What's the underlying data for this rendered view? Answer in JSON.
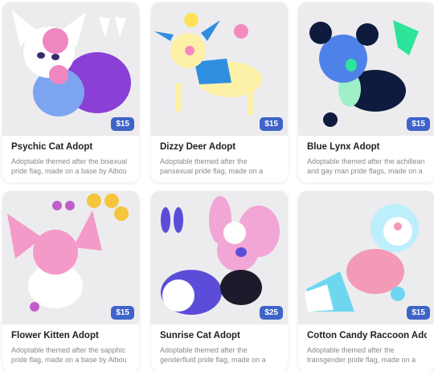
{
  "cards": [
    {
      "title": "Psychic Cat Adopt",
      "description": "Adoptable themed after the bisexual pride flag, made on a base by Aibou on ...",
      "price": "$15",
      "colors": {
        "main": "#8a3fd6",
        "accent": "#7da4f0",
        "hair": "#ef86c2",
        "light": "#ffffff"
      }
    },
    {
      "title": "Dizzy Deer Adopt",
      "description": "Adoptable themed after the pansexual pride flag, made on a base by Aibou on ...",
      "price": "$15",
      "colors": {
        "main": "#fdf1a8",
        "accent": "#2f8ee0",
        "hair": "#f28ac0",
        "light": "#ffe25a"
      }
    },
    {
      "title": "Blue Lynx Adopt",
      "description": "Adoptable themed after the achillean and gay man pride flags, made on a base by ...",
      "price": "$15",
      "colors": {
        "main": "#4f82e8",
        "accent": "#2ee39a",
        "hair": "#0f1b3e",
        "light": "#9ff0c8"
      }
    },
    {
      "title": "Flower Kitten Adopt",
      "description": "Adoptable themed after the sapphic pride flag, made on a base by Aibou on ...",
      "price": "$15",
      "colors": {
        "main": "#f49ac9",
        "accent": "#f5c53d",
        "hair": "#ffffff",
        "light": "#c35ec9"
      }
    },
    {
      "title": "Sunrise Cat Adopt",
      "description": "Adoptable themed after the genderfluid pride flag, made on a base by Aibou on ...",
      "price": "$25",
      "colors": {
        "main": "#f1a6d6",
        "accent": "#5b4dd8",
        "hair": "#1b1b2b",
        "light": "#ffffff"
      }
    },
    {
      "title": "Cotton Candy Raccoon Adopt",
      "description": "Adoptable themed after the transgender pride flag, made on a base by Aibou on ...",
      "price": "$15",
      "colors": {
        "main": "#f39ab6",
        "accent": "#6fd6f0",
        "hair": "#ffffff",
        "light": "#bdeefb"
      }
    }
  ]
}
